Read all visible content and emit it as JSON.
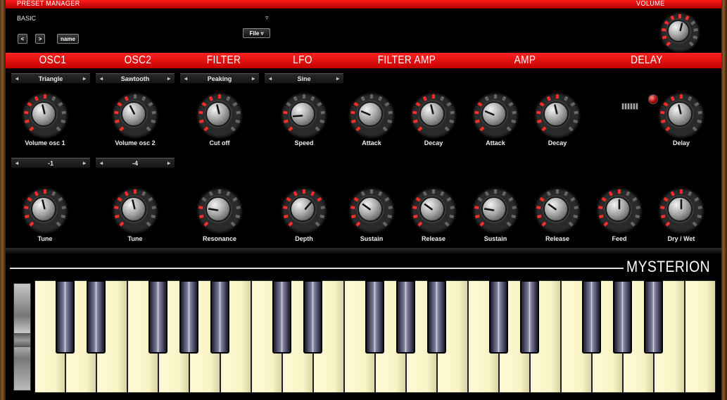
{
  "header": {
    "preset_manager_title": "PRESET MANAGER",
    "volume_title": "VOLUME",
    "preset_name": "BASIC",
    "preset_dropdown_arrow": "▿",
    "prev_label": "<",
    "next_label": ">",
    "name_label": "name",
    "file_label": "File ▿"
  },
  "sections": [
    "OSC1",
    "OSC2",
    "FILTER",
    "LFO",
    "FILTER AMP",
    "AMP",
    "DELAY"
  ],
  "selectors": {
    "osc1_wave": "Triangle",
    "osc2_wave": "Sawtooth",
    "filter_type": "Peaking",
    "lfo_wave": "Sine",
    "osc1_tune": "-1",
    "osc2_tune": "-4"
  },
  "knobs": {
    "volume_osc1": {
      "label": "Volume osc 1",
      "value": 0.45
    },
    "volume_osc2": {
      "label": "Volume osc 2",
      "value": 0.4
    },
    "cutoff": {
      "label": "Cut off",
      "value": 0.45
    },
    "speed": {
      "label": "Speed",
      "value": 0.15
    },
    "attack_filter": {
      "label": "Attack",
      "value": 0.25
    },
    "decay_filter": {
      "label": "Decay",
      "value": 0.45
    },
    "attack_amp": {
      "label": "Attack",
      "value": 0.25
    },
    "decay_amp": {
      "label": "Decay",
      "value": 0.45
    },
    "delay": {
      "label": "Delay",
      "value": 0.45
    },
    "tune_osc1": {
      "label": "Tune",
      "value": 0.45
    },
    "tune_osc2": {
      "label": "Tune",
      "value": 0.45
    },
    "resonance": {
      "label": "Resonance",
      "value": 0.2
    },
    "depth": {
      "label": "Depth",
      "value": 0.65
    },
    "sustain_filter": {
      "label": "Sustain",
      "value": 0.3
    },
    "release_filter": {
      "label": "Release",
      "value": 0.3
    },
    "sustain_amp": {
      "label": "Sustain",
      "value": 0.2
    },
    "release_amp": {
      "label": "Release",
      "value": 0.3
    },
    "feed": {
      "label": "Feed",
      "value": 0.5
    },
    "dry_wet": {
      "label": "Dry / Wet",
      "value": 0.5
    },
    "master_volume": {
      "label": "",
      "value": 0.55
    }
  },
  "brand": "MYSTERION",
  "colors": {
    "accent_red": "#e00000",
    "led_on": "#ff2a2a",
    "led_off": "#666666",
    "key_white": "#fbf6cc"
  },
  "icons": {
    "left": "◂",
    "right": "▸"
  }
}
